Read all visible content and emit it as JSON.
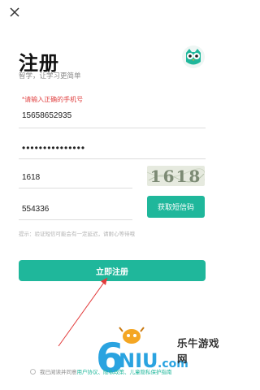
{
  "header": {
    "title": "注册",
    "subtitle": "智学，让学习更简单"
  },
  "form": {
    "error_text": "*请输入正确的手机号",
    "phone_value": "15658652935",
    "password_mask": "•••••••••••••••",
    "captcha_input_value": "1618",
    "captcha_image_text": "1618",
    "sms_code_value": "554336",
    "sms_button_label": "获取短信码",
    "hint_text": "提示：验证短信可能会有一定延迟，请耐心等待哦"
  },
  "actions": {
    "register_label": "立即注册"
  },
  "agreement": {
    "prefix": "我已阅读并同意",
    "links_text": "用户协议、隐私政策、儿童隐私保护指南"
  },
  "watermark": {
    "text": "乐牛游戏网",
    "logo_text": "6NIU.com"
  },
  "colors": {
    "accent": "#1fb79b",
    "error": "#e14444",
    "arrow": "#e23a3a"
  },
  "icons": {
    "close": "close-icon",
    "logo": "owl-logo-icon"
  }
}
